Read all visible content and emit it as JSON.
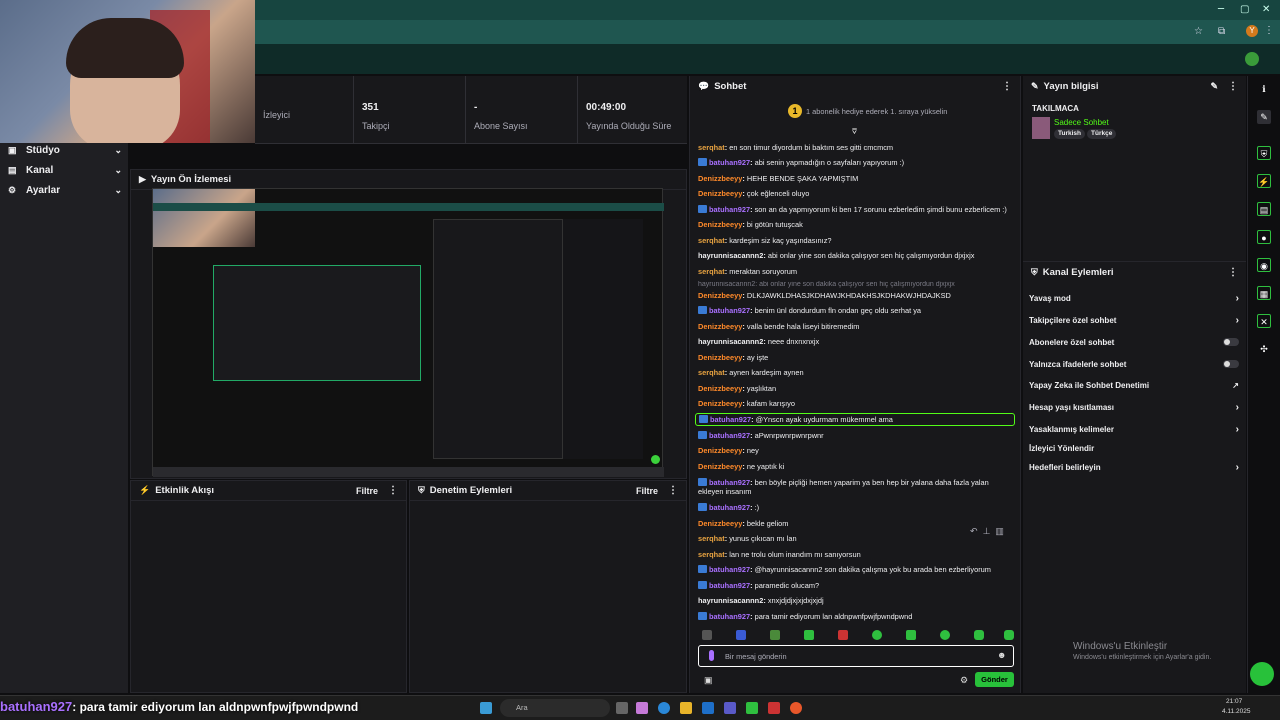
{
  "browser": {
    "window_controls": [
      "─",
      "▢",
      "✕"
    ],
    "profile_initial": "Y"
  },
  "stats": [
    {
      "value": "",
      "label": "İzleyici"
    },
    {
      "value": "351",
      "label": "Takipçi"
    },
    {
      "value": "-",
      "label": "Abone Sayısı"
    },
    {
      "value": "00:49:00",
      "label": "Yayında Olduğu Süre"
    }
  ],
  "leftnav": {
    "items": [
      {
        "label": "Stüdyo",
        "icon": "studio-icon"
      },
      {
        "label": "Kanal",
        "icon": "channel-icon"
      },
      {
        "label": "Ayarlar",
        "icon": "settings-icon"
      }
    ]
  },
  "preview": {
    "title": "Yayın Ön İzlemesi"
  },
  "activity": {
    "title": "Etkinlik Akışı",
    "filter": "Filtre"
  },
  "moderation": {
    "title": "Denetim Eylemleri",
    "filter": "Filtre"
  },
  "chat": {
    "title": "Sohbet",
    "banner": "1 abonelik hediye ederek 1. sıraya yükselin",
    "faded_line": "hayrunnisacannn2: abi onlar yine son dakika çalışıyor sen hiç çalışmıyordun djxjxjx",
    "messages": [
      {
        "user": "serqhat",
        "color": "#e8a341",
        "badge": false,
        "text": "en son timur diyordum bi baktım ses gitti cmcmcm"
      },
      {
        "user": "batuhan927",
        "color": "#a970ff",
        "badge": true,
        "text": "abi senin yapmadığın o sayfaları yapıyorum :)"
      },
      {
        "user": "Denizzbeeyy",
        "color": "#ff8a2a",
        "badge": false,
        "text": "HEHE BENDE ŞAKA YAPMIŞTIM"
      },
      {
        "user": "Denizzbeeyy",
        "color": "#ff8a2a",
        "badge": false,
        "text": "çok eğlenceli oluyo"
      },
      {
        "user": "batuhan927",
        "color": "#a970ff",
        "badge": true,
        "text": "son an da yapmıyorum ki ben 17 sorunu ezberledim şimdi bunu ezberlicem :)"
      },
      {
        "user": "Denizzbeeyy",
        "color": "#ff8a2a",
        "badge": false,
        "text": "bi götün tutuşcak"
      },
      {
        "user": "serqhat",
        "color": "#e8a341",
        "badge": false,
        "text": "kardeşim siz kaç yaşındasınız?"
      },
      {
        "user": "hayrunnisacannn2",
        "color": "#efeff1",
        "badge": false,
        "text": "abi onlar yine son dakika çalışıyor sen hiç çalışmıyordun djxjxjx"
      },
      {
        "user": "serqhat",
        "color": "#e8a341",
        "badge": false,
        "text": "meraktan soruyorum"
      },
      {
        "user": "Denizzbeeyy",
        "color": "#ff8a2a",
        "badge": false,
        "text": "DLKJAWKLDHASJKDHAWJKHDAKHSJKDHAKWJHDAJKSD"
      },
      {
        "user": "batuhan927",
        "color": "#a970ff",
        "badge": true,
        "text": "benim ünl dondurdum fln ondan geç oldu serhat ya"
      },
      {
        "user": "Denizzbeeyy",
        "color": "#ff8a2a",
        "badge": false,
        "text": "valla bende hala liseyi bitiremedim"
      },
      {
        "user": "hayrunnisacannn2",
        "color": "#efeff1",
        "badge": false,
        "text": "neee dnxnxnxjx"
      },
      {
        "user": "Denizzbeeyy",
        "color": "#ff8a2a",
        "badge": false,
        "text": "ay işte"
      },
      {
        "user": "serqhat",
        "color": "#e8a341",
        "badge": false,
        "text": "aynen kardeşim aynen"
      },
      {
        "user": "Denizzbeeyy",
        "color": "#ff8a2a",
        "badge": false,
        "text": "yaşlıktan"
      },
      {
        "user": "Denizzbeeyy",
        "color": "#ff8a2a",
        "badge": false,
        "text": "kafam karışıyo"
      },
      {
        "user": "batuhan927",
        "color": "#a970ff",
        "badge": true,
        "text": "@Ynscn ayak uydurmam mükemmel ama",
        "highlight": true
      },
      {
        "user": "batuhan927",
        "color": "#a970ff",
        "badge": true,
        "text": "aPwnrpwnrpwnrpwnr"
      },
      {
        "user": "Denizzbeeyy",
        "color": "#ff8a2a",
        "badge": false,
        "text": "ney"
      },
      {
        "user": "Denizzbeeyy",
        "color": "#ff8a2a",
        "badge": false,
        "text": "ne yaptık ki"
      },
      {
        "user": "batuhan927",
        "color": "#a970ff",
        "badge": true,
        "text": "ben böyle piçliği hemen yaparim ya ben hep bir yalana daha fazla yalan ekleyen insanım",
        "wrap": true
      },
      {
        "user": "batuhan927",
        "color": "#a970ff",
        "badge": true,
        "text": ":)"
      },
      {
        "user": "Denizzbeeyy",
        "color": "#ff8a2a",
        "badge": false,
        "text": "bekle geliom"
      },
      {
        "user": "serqhat",
        "color": "#e8a341",
        "badge": false,
        "text": "yunus çıkıcan mı lan"
      },
      {
        "user": "serqhat",
        "color": "#e8a341",
        "badge": false,
        "text": "lan ne trolu olum inandım mı sanıyorsun"
      },
      {
        "user": "batuhan927",
        "color": "#a970ff",
        "badge": true,
        "text": "@hayrunnisacannn2 son dakika çalışma yok bu arada ben ezberliyorum"
      },
      {
        "user": "batuhan927",
        "color": "#a970ff",
        "badge": true,
        "text": "paramedic olucam?"
      },
      {
        "user": "hayrunnisacannn2",
        "color": "#efeff1",
        "badge": false,
        "text": "xnxjdjdjxjxjdxjxjdj"
      },
      {
        "user": "batuhan927",
        "color": "#a970ff",
        "badge": true,
        "text": "para tamir ediyorum lan aldnpwnfpwjfpwndpwnd"
      }
    ],
    "input_placeholder": "Bir mesaj gönderin",
    "send_label": "Gönder"
  },
  "stream_info": {
    "title": "Yayın bilgisi",
    "stream_title": "TAKILMACA",
    "category": "Sadece Sohbet",
    "tags": [
      "Turkish",
      "Türkçe"
    ]
  },
  "channel_actions": {
    "title": "Kanal Eylemleri",
    "items": [
      {
        "label": "Yavaş mod",
        "control": "arrow"
      },
      {
        "label": "Takipçilere özel sohbet",
        "control": "arrow"
      },
      {
        "label": "Abonelere özel sohbet",
        "control": "toggle"
      },
      {
        "label": "Yalnızca ifadelerle sohbet",
        "control": "toggle"
      },
      {
        "label": "Yapay Zeka ile Sohbet Denetimi",
        "control": "external"
      },
      {
        "label": "Hesap yaşı kısıtlaması",
        "control": "arrow"
      },
      {
        "label": "Yasaklanmış kelimeler",
        "control": "arrow"
      },
      {
        "label": "İzleyici Yönlendir",
        "control": "none"
      },
      {
        "label": "Hedefleri belirleyin",
        "control": "arrow"
      }
    ]
  },
  "watermark": {
    "title": "Windows'u Etkinleştir",
    "subtitle": "Windows'u etkinleştirmek için Ayarlar'a gidin."
  },
  "caption": {
    "user": "batuhan927",
    "text": ": para tamir ediyorum lan aldnpwnfpwjfpwndpwnd"
  },
  "taskbar": {
    "search": "Ara",
    "time": "21:07",
    "date": "4.11.2025"
  }
}
